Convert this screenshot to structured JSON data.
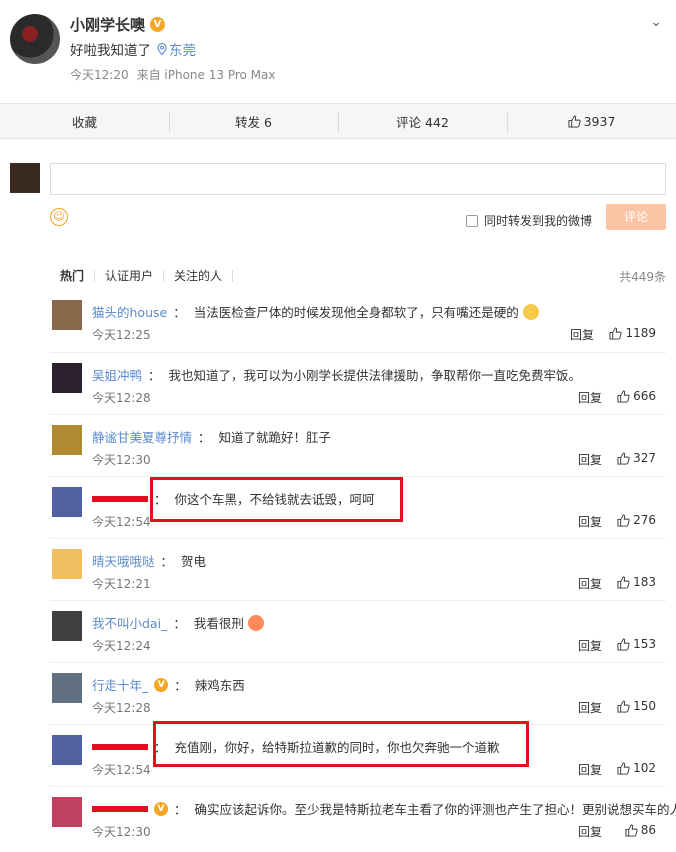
{
  "post": {
    "author": "小刚学长噢",
    "text": "好啦我知道了",
    "location": "东莞",
    "time": "今天12:20",
    "source": "来自 iPhone 13 Pro Max"
  },
  "actions": {
    "favorite": "收藏",
    "repost": "转发 6",
    "comment": "评论 442",
    "like": "3937"
  },
  "composer": {
    "input_value": "",
    "repost_label": "同时转发到我的微博",
    "submit_label": "评论"
  },
  "filters": {
    "tabs": [
      "热门",
      "认证用户",
      "关注的人"
    ],
    "total": "共449条"
  },
  "comments": [
    {
      "user": "猫头的house",
      "text": "当法医检查尸体的时候发现他全身都软了，只有嘴还是硬的",
      "time": "今天12:25",
      "reply": "回复",
      "likes": "1189",
      "emoji": "doge"
    },
    {
      "user": "吴姐冲鸭",
      "text": "我也知道了，我可以为小刚学长提供法律援助，争取帮你一直吃免费牢饭。",
      "time": "今天12:28",
      "reply": "回复",
      "likes": "666"
    },
    {
      "user": "静谧甘美夏尊抒情",
      "text": "知道了就跪好！肛子",
      "time": "今天12:30",
      "reply": "回复",
      "likes": "327"
    },
    {
      "user": "",
      "text": "你这个车黑，不给钱就去诋毁，呵呵",
      "time": "今天12:54",
      "reply": "回复",
      "likes": "276",
      "redacted": true
    },
    {
      "user": "晴天哦哦哒",
      "text": "贺电",
      "time": "今天12:21",
      "reply": "回复",
      "likes": "183"
    },
    {
      "user": "我不叫小dai_",
      "text": "我看很刑",
      "time": "今天12:24",
      "reply": "回复",
      "likes": "153",
      "emoji": "love"
    },
    {
      "user": "行走十年_",
      "text": "辣鸡东西",
      "time": "今天12:28",
      "reply": "回复",
      "likes": "150",
      "verified": true
    },
    {
      "user": "",
      "text": "充值刚，你好，给特斯拉道歉的同时，你也欠奔驰一个道歉",
      "time": "今天12:54",
      "reply": "回复",
      "likes": "102",
      "redacted": true
    },
    {
      "user": "",
      "text": "确实应该起诉你。至少我是特斯拉老车主看了你的评测也产生了担心！更别说想买车的人了",
      "time": "今天12:30",
      "reply": "回复",
      "likes": "86",
      "redacted": true,
      "verified": true
    }
  ],
  "colors": {
    "highlight": "#e0101c",
    "link": "#5b8bd0",
    "verified": "#f5a623",
    "submit": "#fbc4a4"
  }
}
